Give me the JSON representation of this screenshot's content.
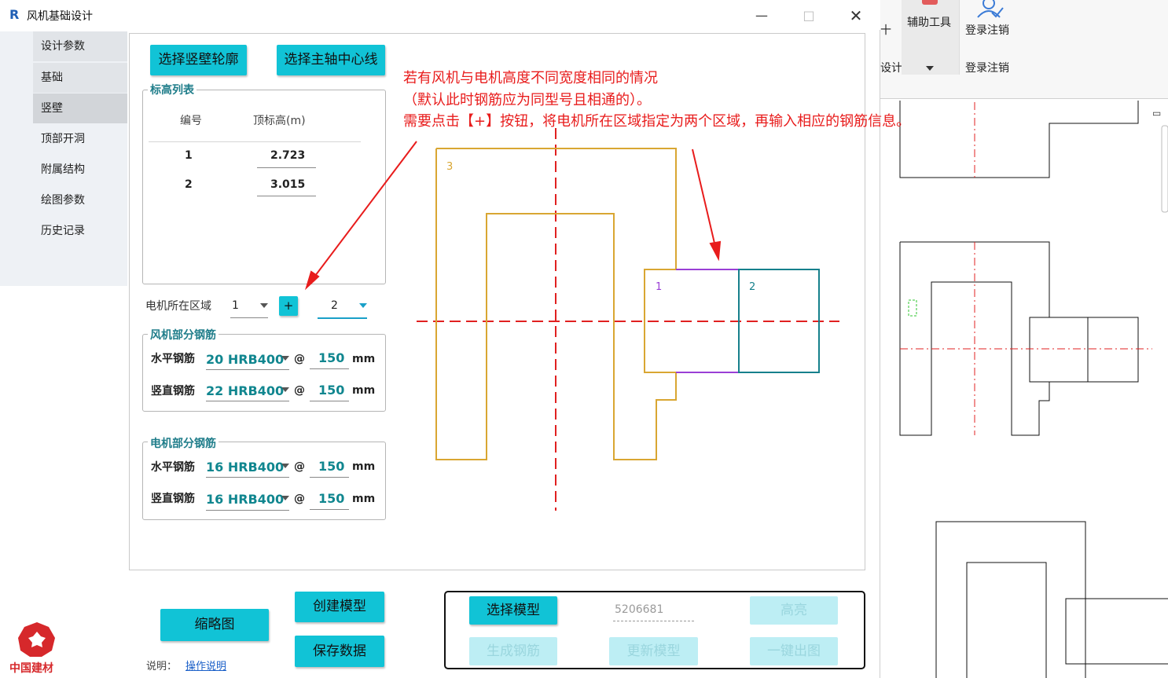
{
  "background_app": {
    "ribbon": {
      "tab_partial_1": "十",
      "tab_partial_2": "设计",
      "aux_tools": "辅助工具",
      "login_logout_top": "登录注销",
      "login_logout_bottom": "登录注销"
    }
  },
  "window": {
    "title": "风机基础设计",
    "icon_letter": "R"
  },
  "sidebar": {
    "items": [
      {
        "label": "设计参数"
      },
      {
        "label": "基础"
      },
      {
        "label": "竖壁"
      },
      {
        "label": "顶部开洞"
      },
      {
        "label": "附属结构"
      },
      {
        "label": "绘图参数"
      },
      {
        "label": "历史记录"
      }
    ],
    "active_index": 2
  },
  "top_buttons": {
    "select_wall_outline": "选择竖壁轮廓",
    "select_main_axis": "选择主轴中心线"
  },
  "elevation_list": {
    "title": "标高列表",
    "col_no": "编号",
    "col_top_elev": "顶标高(m)",
    "rows": [
      {
        "no": "1",
        "elev": "2.723"
      },
      {
        "no": "2",
        "elev": "3.015"
      }
    ]
  },
  "motor_region": {
    "label": "电机所在区域",
    "first_value": "1",
    "plus_button": "+",
    "second_value": "2"
  },
  "fan_rebar": {
    "title": "风机部分钢筋",
    "horizontal_label": "水平钢筋",
    "horizontal_bar": "20 HRB400",
    "horizontal_spacing": "150",
    "vertical_label": "竖直钢筋",
    "vertical_bar": "22 HRB400",
    "vertical_spacing": "150",
    "at": "@",
    "unit": "mm"
  },
  "motor_rebar": {
    "title": "电机部分钢筋",
    "horizontal_label": "水平钢筋",
    "horizontal_bar": "16 HRB400",
    "horizontal_spacing": "150",
    "vertical_label": "竖直钢筋",
    "vertical_bar": "16 HRB400",
    "vertical_spacing": "150",
    "at": "@",
    "unit": "mm"
  },
  "annotation": {
    "line1": "若有风机与电机高度不同宽度相同的情况",
    "line2": "（默认此时钢筋应为同型号且相通的）。",
    "line3": "需要点击【+】按钮，将电机所在区域指定为两个区域，再输入相应的钢筋信息。",
    "color": "#e81c1c"
  },
  "drawing": {
    "region_labels": [
      "3",
      "1",
      "2"
    ],
    "colors": {
      "wall": "#d9a632",
      "region1": "#9a3fd6",
      "region2": "#16808c",
      "axis": "#e02020"
    }
  },
  "bottom": {
    "thumbnail_button": "缩略图",
    "create_model_button": "创建模型",
    "save_data_button": "保存数据",
    "note_label": "说明：",
    "note_link": "操作说明",
    "select_model_button": "选择模型",
    "model_id": "5206681",
    "highlight_button": "高亮",
    "gen_rebar_button": "生成钢筋",
    "update_model_button": "更新模型",
    "one_click_drawing_button": "一键出图"
  },
  "logo": {
    "text": "中国建材"
  }
}
